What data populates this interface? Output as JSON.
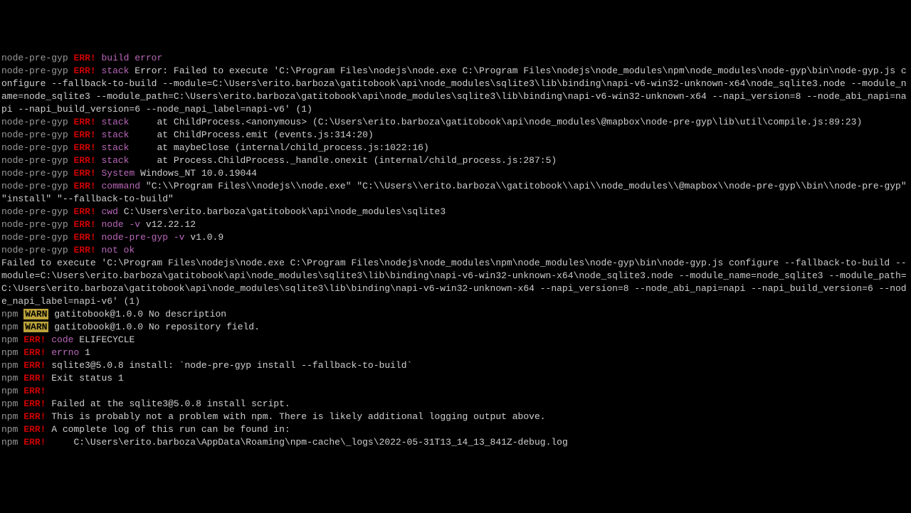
{
  "lines": {
    "l1": {
      "prefix": "node-pre-gyp",
      "err": "ERR!",
      "tag": "build error"
    },
    "l2": {
      "prefix": "node-pre-gyp",
      "err": "ERR!",
      "tag": "stack",
      "msg": "Error: Failed to execute 'C:\\Program Files\\nodejs\\node.exe C:\\Program Files\\nodejs\\node_modules\\npm\\node_modules\\node-gyp\\bin\\node-gyp.js configure --fallback-to-build --module=C:\\Users\\erito.barboza\\gatitobook\\api\\node_modules\\sqlite3\\lib\\binding\\napi-v6-win32-unknown-x64\\node_sqlite3.node --module_name=node_sqlite3 --module_path=C:\\Users\\erito.barboza\\gatitobook\\api\\node_modules\\sqlite3\\lib\\binding\\napi-v6-win32-unknown-x64 --napi_version=8 --node_abi_napi=napi --napi_build_version=6 --node_napi_label=napi-v6' (1)"
    },
    "l3": {
      "prefix": "node-pre-gyp",
      "err": "ERR!",
      "tag": "stack",
      "msg": "    at ChildProcess.<anonymous> (C:\\Users\\erito.barboza\\gatitobook\\api\\node_modules\\@mapbox\\node-pre-gyp\\lib\\util\\compile.js:89:23)"
    },
    "l4": {
      "prefix": "node-pre-gyp",
      "err": "ERR!",
      "tag": "stack",
      "msg": "    at ChildProcess.emit (events.js:314:20)"
    },
    "l5": {
      "prefix": "node-pre-gyp",
      "err": "ERR!",
      "tag": "stack",
      "msg": "    at maybeClose (internal/child_process.js:1022:16)"
    },
    "l6": {
      "prefix": "node-pre-gyp",
      "err": "ERR!",
      "tag": "stack",
      "msg": "    at Process.ChildProcess._handle.onexit (internal/child_process.js:287:5)"
    },
    "l7": {
      "prefix": "node-pre-gyp",
      "err": "ERR!",
      "tag": "System",
      "msg": "Windows_NT 10.0.19044"
    },
    "l8": {
      "prefix": "node-pre-gyp",
      "err": "ERR!",
      "tag": "command",
      "msg": "\"C:\\\\Program Files\\\\nodejs\\\\node.exe\" \"C:\\\\Users\\\\erito.barboza\\\\gatitobook\\\\api\\\\node_modules\\\\@mapbox\\\\node-pre-gyp\\\\bin\\\\node-pre-gyp\" \"install\" \"--fallback-to-build\""
    },
    "l9": {
      "prefix": "node-pre-gyp",
      "err": "ERR!",
      "tag": "cwd",
      "msg": "C:\\Users\\erito.barboza\\gatitobook\\api\\node_modules\\sqlite3"
    },
    "l10": {
      "prefix": "node-pre-gyp",
      "err": "ERR!",
      "tag": "node -v",
      "msg": "v12.22.12"
    },
    "l11": {
      "prefix": "node-pre-gyp",
      "err": "ERR!",
      "tag": "node-pre-gyp -v",
      "msg": "v1.0.9"
    },
    "l12": {
      "prefix": "node-pre-gyp",
      "err": "ERR!",
      "tag": "not ok"
    },
    "l13": {
      "msg": "Failed to execute 'C:\\Program Files\\nodejs\\node.exe C:\\Program Files\\nodejs\\node_modules\\npm\\node_modules\\node-gyp\\bin\\node-gyp.js configure --fallback-to-build --module=C:\\Users\\erito.barboza\\gatitobook\\api\\node_modules\\sqlite3\\lib\\binding\\napi-v6-win32-unknown-x64\\node_sqlite3.node --module_name=node_sqlite3 --module_path=C:\\Users\\erito.barboza\\gatitobook\\api\\node_modules\\sqlite3\\lib\\binding\\napi-v6-win32-unknown-x64 --napi_version=8 --node_abi_napi=napi --napi_build_version=6 --node_napi_label=napi-v6' (1)"
    },
    "l14": {
      "prefix": "npm",
      "warn": "WARN",
      "msg": "gatitobook@1.0.0 No description"
    },
    "l15": {
      "prefix": "npm",
      "warn": "WARN",
      "msg": "gatitobook@1.0.0 No repository field."
    },
    "blank1": "",
    "l16": {
      "prefix": "npm",
      "err": "ERR!",
      "tag": "code",
      "msg": "ELIFECYCLE"
    },
    "l17": {
      "prefix": "npm",
      "err": "ERR!",
      "tag": "errno",
      "msg": "1"
    },
    "l18": {
      "prefix": "npm",
      "err": "ERR!",
      "msg": "sqlite3@5.0.8 install: `node-pre-gyp install --fallback-to-build`"
    },
    "l19": {
      "prefix": "npm",
      "err": "ERR!",
      "msg": "Exit status 1"
    },
    "l20": {
      "prefix": "npm",
      "err": "ERR!"
    },
    "l21": {
      "prefix": "npm",
      "err": "ERR!",
      "msg": "Failed at the sqlite3@5.0.8 install script."
    },
    "l22": {
      "prefix": "npm",
      "err": "ERR!",
      "msg": "This is probably not a problem with npm. There is likely additional logging output above."
    },
    "blank2": "",
    "l23": {
      "prefix": "npm",
      "err": "ERR!",
      "msg": "A complete log of this run can be found in:"
    },
    "l24": {
      "prefix": "npm",
      "err": "ERR!",
      "msg": "    C:\\Users\\erito.barboza\\AppData\\Roaming\\npm-cache\\_logs\\2022-05-31T13_14_13_841Z-debug.log"
    }
  }
}
